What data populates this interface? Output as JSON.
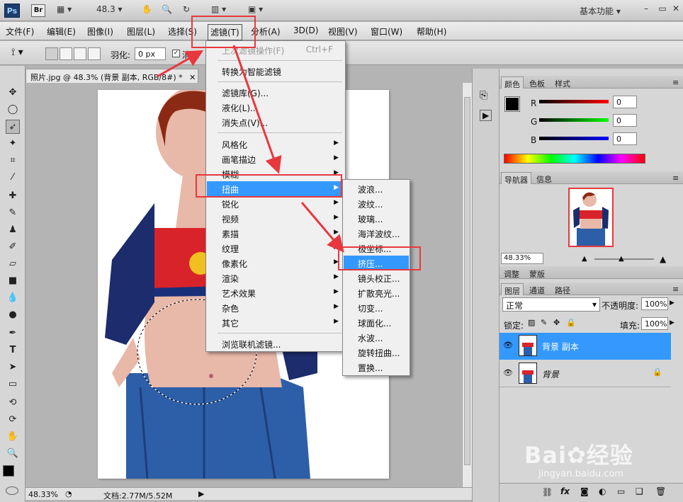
{
  "appbar": {
    "logo": "Ps",
    "bridge": "Br",
    "zoom": "48.3",
    "workspace": "基本功能"
  },
  "menubar": [
    "文件(F)",
    "编辑(E)",
    "图像(I)",
    "图层(L)",
    "选择(S)",
    "滤镜(T)",
    "分析(A)",
    "3D(D)",
    "视图(V)",
    "窗口(W)",
    "帮助(H)"
  ],
  "options": {
    "feather_label": "羽化:",
    "feather_value": "0 px",
    "antialias": "消除"
  },
  "document": {
    "tab_title": "照片.jpg @ 48.3% (背景 副本, RGB/8#) *",
    "zoom": "48.33%",
    "doc_size": "文档:2.77M/5.52M"
  },
  "filter_menu": {
    "last_filter": "上次滤镜操作(F)",
    "last_filter_shortcut": "Ctrl+F",
    "smart": "转换为智能滤镜",
    "gallery": "滤镜库(G)...",
    "liquify": "液化(L)...",
    "vanish": "消失点(V)...",
    "stylize": "风格化",
    "brush": "画笔描边",
    "blur": "模糊",
    "distort": "扭曲",
    "sharpen": "锐化",
    "video": "视频",
    "sketch": "素描",
    "texture": "纹理",
    "pixelate": "像素化",
    "render": "渲染",
    "artistic": "艺术效果",
    "noise": "杂色",
    "other": "其它",
    "browse": "浏览联机滤镜..."
  },
  "distort_menu": [
    "波浪...",
    "波纹...",
    "玻璃...",
    "海洋波纹...",
    "极坐标...",
    "挤压...",
    "镜头校正...",
    "扩散亮光...",
    "切变...",
    "球面化...",
    "水波...",
    "旋转扭曲...",
    "置换..."
  ],
  "color_panel": {
    "tabs": [
      "颜色",
      "色板",
      "样式"
    ],
    "r_label": "R",
    "g_label": "G",
    "b_label": "B",
    "r": "0",
    "g": "0",
    "b": "0"
  },
  "navigator": {
    "tabs": [
      "导航器",
      "信息"
    ],
    "zoom": "48.33%"
  },
  "adjust_tabs": [
    "调整",
    "蒙版"
  ],
  "layers": {
    "tabs": [
      "图层",
      "通道",
      "路径"
    ],
    "blend": "正常",
    "opacity_label": "不透明度:",
    "opacity": "100%",
    "lock_label": "锁定:",
    "fill_label": "填充:",
    "fill": "100%",
    "items": [
      "背景 副本",
      "背景"
    ]
  },
  "watermark": {
    "brand": "Bai",
    "brand2": "经验",
    "url": "jingyan.baidu.com"
  }
}
